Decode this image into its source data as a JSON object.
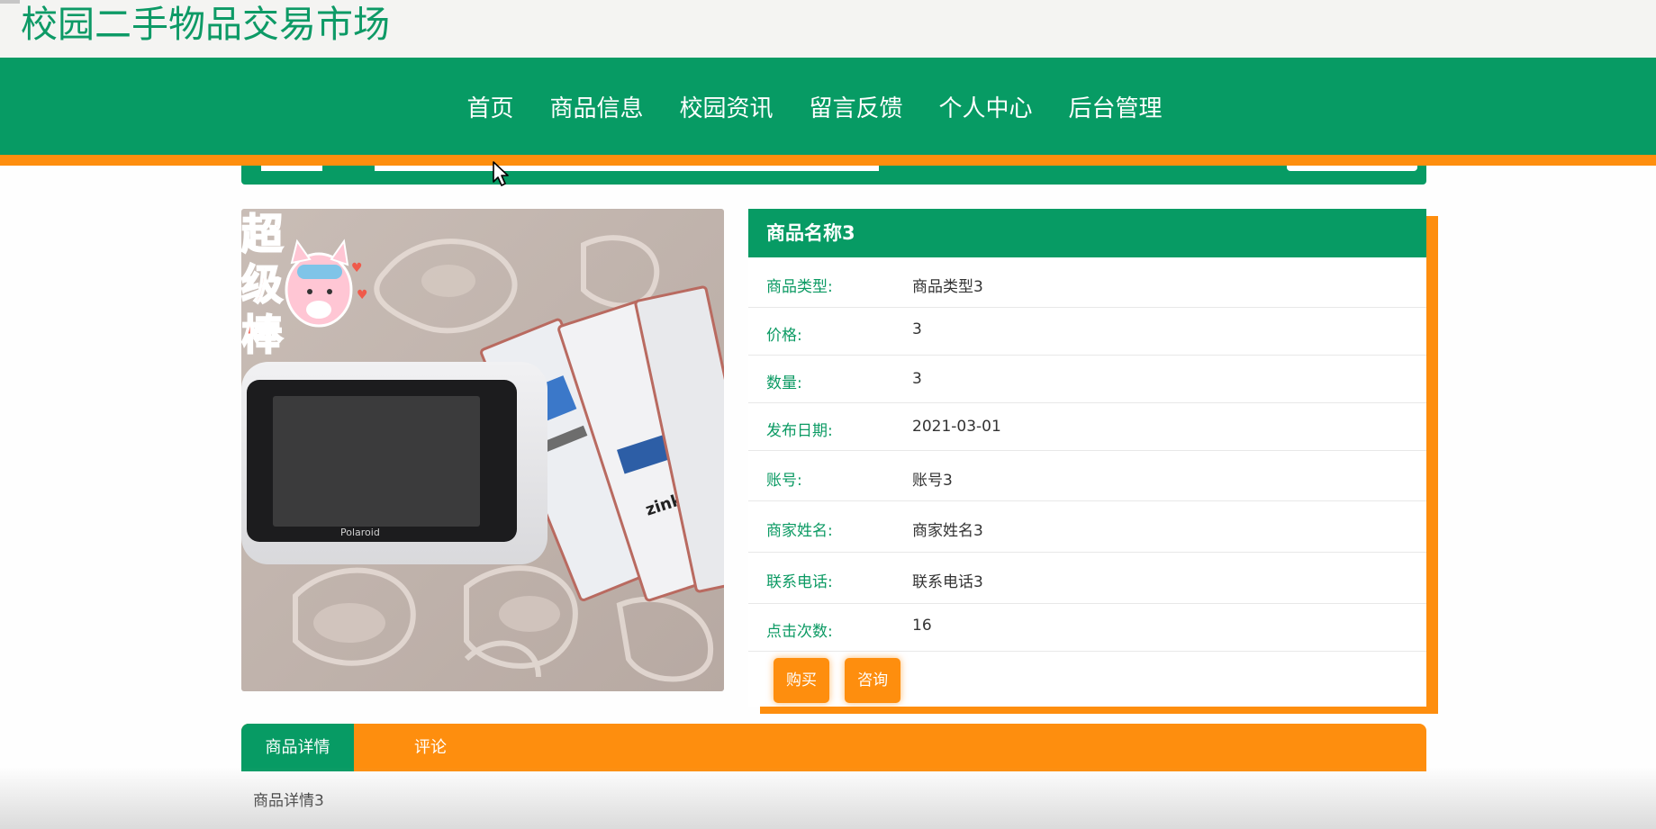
{
  "site": {
    "title": "校园二手物品交易市场"
  },
  "nav": {
    "items": [
      "首页",
      "商品信息",
      "校园资讯",
      "留言反馈",
      "个人中心",
      "后台管理"
    ]
  },
  "product": {
    "name": "商品名称3",
    "fields": [
      {
        "label": "商品类型:",
        "value": "商品类型3"
      },
      {
        "label": "价格:",
        "value": "3"
      },
      {
        "label": "数量:",
        "value": "3"
      },
      {
        "label": "发布日期:",
        "value": "2021-03-01"
      },
      {
        "label": "账号:",
        "value": "账号3"
      },
      {
        "label": "商家姓名:",
        "value": "商家姓名3"
      },
      {
        "label": "联系电话:",
        "value": "联系电话3"
      },
      {
        "label": "点击次数:",
        "value": "16"
      }
    ],
    "buttons": {
      "buy": "购买",
      "inquire": "咨询"
    }
  },
  "tabs": {
    "items": [
      "商品详情",
      "评论"
    ],
    "active": 0,
    "content": "商品详情3"
  },
  "photo": {
    "sticker_text": [
      "超",
      "级",
      "棒"
    ],
    "device_brand": "Polaroid",
    "pack_text": "zink"
  },
  "colors": {
    "primary_green": "#079b64",
    "accent_orange": "#fe8e0e",
    "title_green": "#0d9a66"
  }
}
